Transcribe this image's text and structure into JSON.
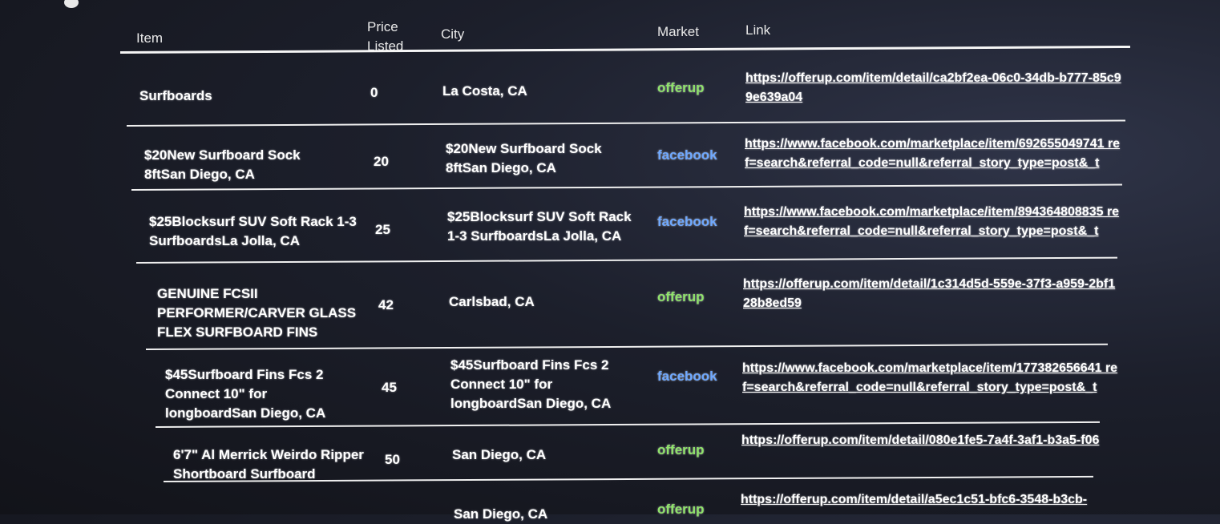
{
  "table": {
    "headers": {
      "item": "Item",
      "price": "Price Listed",
      "city": "City",
      "market": "Market",
      "link": "Link"
    },
    "rows": [
      {
        "item": "Surfboards",
        "price": "0",
        "city": "La Costa, CA",
        "market": "offerup",
        "link": "https://offerup.com/item/detail/ca2bf2ea-06c0-34db-b777-85c99e639a04"
      },
      {
        "item": "$20New Surfboard Sock 8ftSan Diego, CA",
        "price": "20",
        "city": "$20New Surfboard Sock 8ftSan Diego, CA",
        "market": "facebook",
        "link": "https://www.facebook.com/marketplace/item/692655049741 ref=search&referral_code=null&referral_story_type=post&_t"
      },
      {
        "item": "$25Blocksurf SUV Soft Rack 1-3 SurfboardsLa Jolla, CA",
        "price": "25",
        "city": "$25Blocksurf SUV Soft Rack 1-3 SurfboardsLa Jolla, CA",
        "market": "facebook",
        "link": "https://www.facebook.com/marketplace/item/894364808835 ref=search&referral_code=null&referral_story_type=post&_t"
      },
      {
        "item": "GENUINE FCSII PERFORMER/CARVER GLASS FLEX SURFBOARD FINS",
        "price": "42",
        "city": "Carlsbad, CA",
        "market": "offerup",
        "link": "https://offerup.com/item/detail/1c314d5d-559e-37f3-a959-2bf128b8ed59"
      },
      {
        "item": "$45Surfboard Fins Fcs 2 Connect 10\" for longboardSan Diego, CA",
        "price": "45",
        "city": "$45Surfboard Fins Fcs 2 Connect 10\" for longboardSan Diego, CA",
        "market": "facebook",
        "link": "https://www.facebook.com/marketplace/item/177382656641 ref=search&referral_code=null&referral_story_type=post&_t"
      },
      {
        "item": "6'7\" Al Merrick Weirdo Ripper Shortboard Surfboard",
        "price": "50",
        "city": "San Diego, CA",
        "market": "offerup",
        "link": "https://offerup.com/item/detail/080e1fe5-7a4f-3af1-b3a5-f06"
      },
      {
        "item": "",
        "price": "",
        "city": "San Diego, CA",
        "market": "offerup",
        "link": "https://offerup.com/item/detail/a5ec1c51-bfc6-3548-b3cb-"
      }
    ]
  }
}
